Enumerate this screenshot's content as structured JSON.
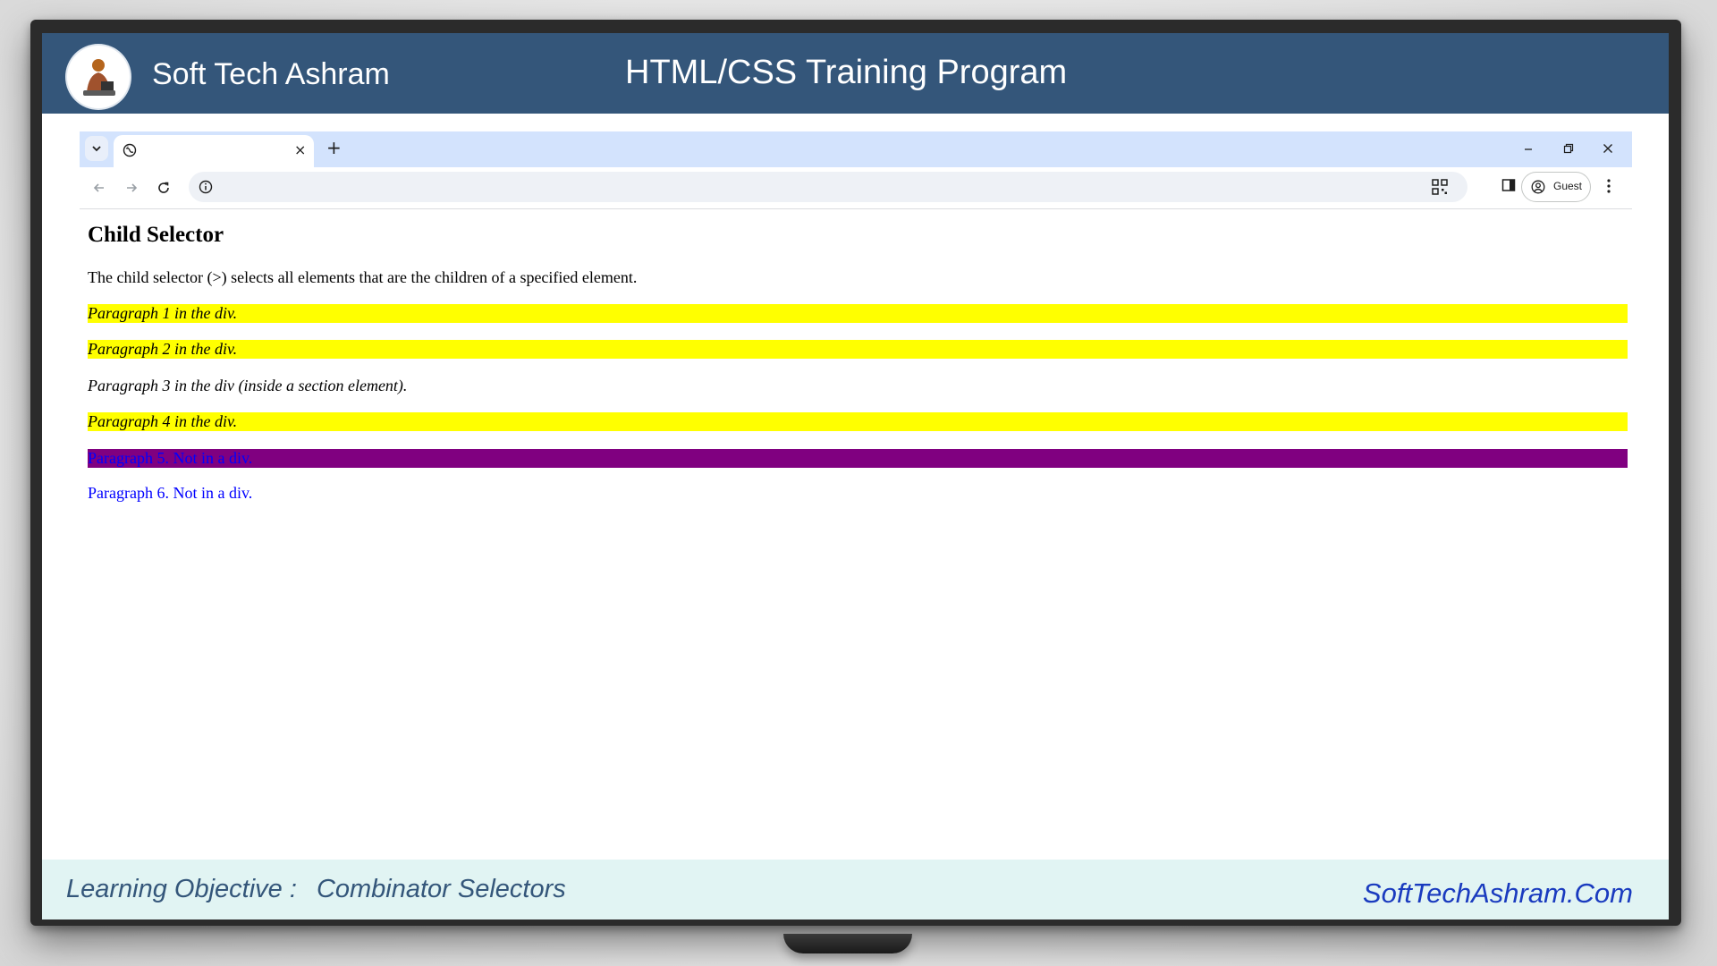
{
  "banner": {
    "brand": "Soft Tech Ashram",
    "title": "HTML/CSS Training Program"
  },
  "browser": {
    "profile_label": "Guest",
    "new_tab_label": "+",
    "tab_close_label": "×"
  },
  "page": {
    "heading": "Child Selector",
    "intro": "The child selector (>) selects all elements that are the children of a specified element.",
    "paragraphs": [
      {
        "text": "Paragraph 1 in the div.",
        "bg": "#ffff00",
        "color": "#000000",
        "italic": true
      },
      {
        "text": "Paragraph 2 in the div.",
        "bg": "#ffff00",
        "color": "#000000",
        "italic": true
      },
      {
        "text": "Paragraph 3 in the div (inside a section element).",
        "bg": "transparent",
        "color": "#000000",
        "italic": true
      },
      {
        "text": "Paragraph 4 in the div.",
        "bg": "#ffff00",
        "color": "#000000",
        "italic": true
      },
      {
        "text": "Paragraph 5. Not in a div.",
        "bg": "#800080",
        "color": "#0000ff",
        "italic": false
      },
      {
        "text": "Paragraph 6. Not in a div.",
        "bg": "transparent",
        "color": "#0000ff",
        "italic": false
      }
    ]
  },
  "footer": {
    "objective_label": "Learning Objective :",
    "objective_topic": "Combinator Selectors",
    "website": "SoftTechAshram.Com",
    "website_color": "#1a3bbf"
  },
  "colors": {
    "banner": "#34567a",
    "tabbar": "#d3e3fd",
    "footer_bg": "#e1f4f3"
  }
}
